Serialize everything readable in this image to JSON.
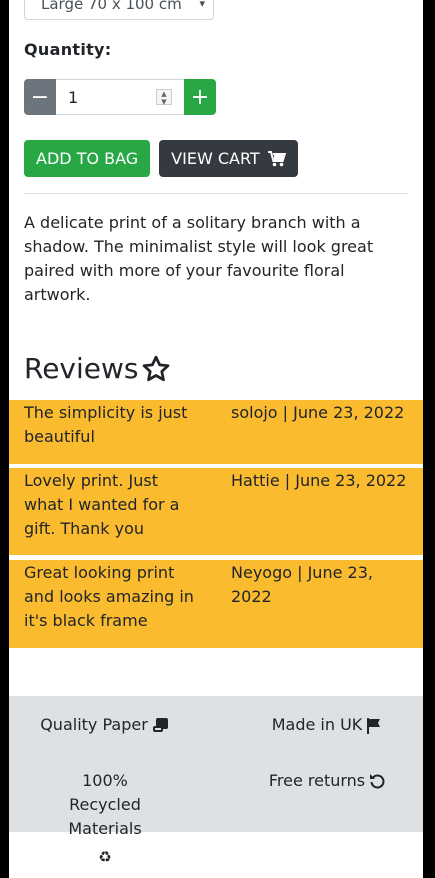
{
  "product": {
    "size_select_value": "Large 70 x 100 cm",
    "quantity_label": "Quantity:",
    "quantity_value": "1",
    "minus_label": "−",
    "plus_label": "+",
    "add_to_bag_label": "ADD TO BAG",
    "view_cart_label": "VIEW CART",
    "description": "A delicate print of a solitary branch with a shadow. The minimalist style will look great paired with more of your favourite floral artwork."
  },
  "reviews": {
    "heading": "Reviews",
    "items": [
      {
        "text": "The simplicity is just beautiful",
        "meta": "solojo | June 23, 2022"
      },
      {
        "text": "Lovely print. Just what I wanted for a gift. Thank you",
        "meta": "Hattie | June 23, 2022"
      },
      {
        "text": "Great looking print and looks amazing in it's black frame",
        "meta": "Neyogo | June 23, 2022"
      }
    ]
  },
  "features": {
    "quality_paper": "Quality Paper",
    "made_in_uk": "Made in UK",
    "recycled": "100% Recycled Materials",
    "free_returns": "Free returns"
  },
  "colors": {
    "accent_green": "#28a745",
    "dark_button": "#343a40",
    "review_bg": "#fbbb2f",
    "features_bg": "#dee1e4"
  }
}
